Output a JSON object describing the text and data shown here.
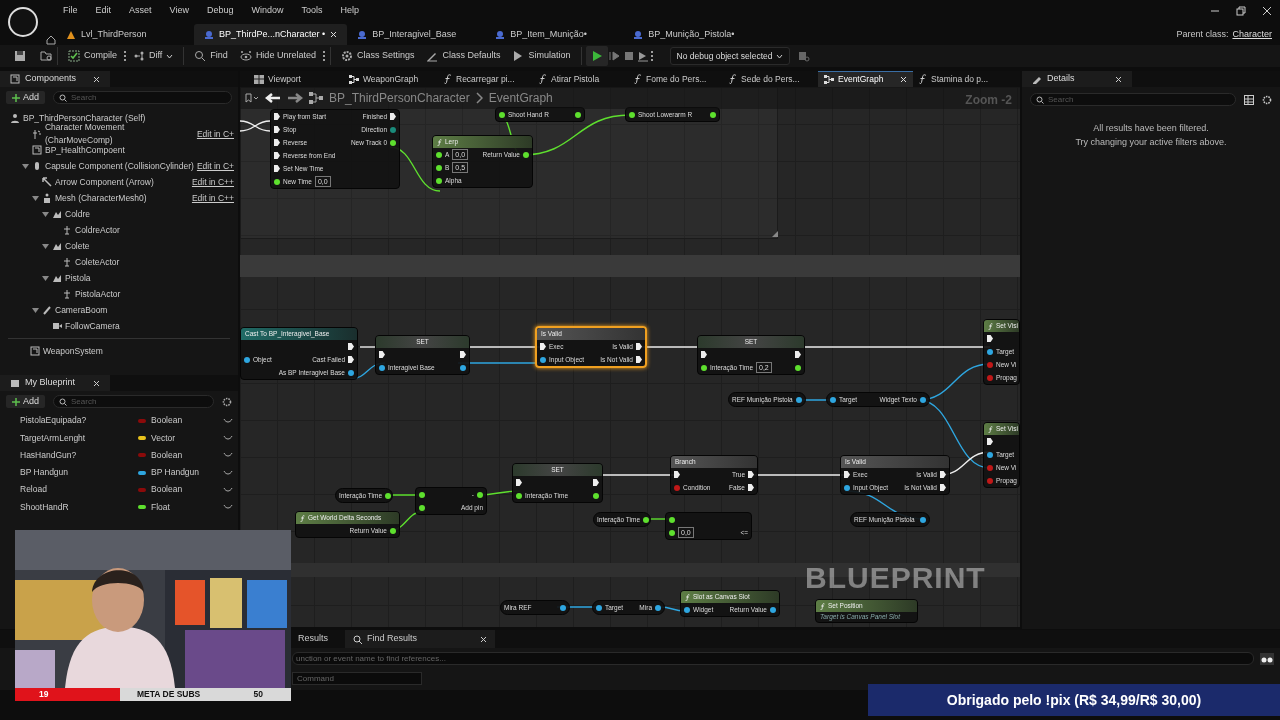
{
  "menu": [
    "File",
    "Edit",
    "Asset",
    "View",
    "Debug",
    "Window",
    "Tools",
    "Help"
  ],
  "doc_tabs": [
    {
      "label": "Lvl_ThirdPerson",
      "kind": "level",
      "selected": false
    },
    {
      "label": "BP_ThirdPe...nCharacter •",
      "kind": "blueprint",
      "selected": true
    },
    {
      "label": "BP_Interagivel_Base",
      "kind": "blueprint",
      "selected": false
    },
    {
      "label": "BP_Item_Munição•",
      "kind": "blueprint",
      "selected": false
    },
    {
      "label": "BP_Munição_Pistola•",
      "kind": "blueprint",
      "selected": false
    }
  ],
  "parent_class": {
    "label": "Parent class:",
    "value": "Character"
  },
  "toolbar": [
    {
      "label": "Compile",
      "kind": "compile",
      "more": true,
      "dropdown": false
    },
    {
      "label": "Diff",
      "kind": "diff",
      "more": false,
      "dropdown": true
    },
    {
      "label": "Find",
      "kind": "find",
      "more": false,
      "dropdown": false
    },
    {
      "label": "Hide Unrelated",
      "kind": "hide",
      "more": true,
      "dropdown": false
    },
    {
      "label": "Class Settings",
      "kind": "settings",
      "more": false,
      "dropdown": false
    },
    {
      "label": "Class Defaults",
      "kind": "defaults",
      "more": false,
      "dropdown": false
    },
    {
      "label": "Simulation",
      "kind": "simulation",
      "more": false,
      "dropdown": false
    }
  ],
  "debug_select": "No debug object selected",
  "components": {
    "title": "Components",
    "add": "Add",
    "search_placeholder": "Search",
    "root": {
      "name": "BP_ThirdPersonCharacter (Self)",
      "kind": "character"
    },
    "tree": [
      {
        "name": "Character Movement (CharMoveComp)",
        "kind": "movement",
        "edit": "Edit in C+"
      },
      {
        "name": "BP_HealthCompoent",
        "kind": "component"
      },
      {
        "name": "Capsule Component (CollisionCylinder)",
        "kind": "capsule",
        "edit": "Edit in C+",
        "expanded": true,
        "children": [
          {
            "name": "Arrow Component (Arrow)",
            "kind": "arrow",
            "edit": "Edit in C++"
          },
          {
            "name": "Mesh (CharacterMesh0)",
            "kind": "mesh",
            "edit": "Edit in C++",
            "expanded": true,
            "children": [
              {
                "name": "Coldre",
                "kind": "socket",
                "expanded": true,
                "children": [
                  {
                    "name": "ColdreActor",
                    "kind": "actor"
                  }
                ]
              },
              {
                "name": "Colete",
                "kind": "socket",
                "expanded": true,
                "children": [
                  {
                    "name": "ColeteActor",
                    "kind": "actor"
                  }
                ]
              },
              {
                "name": "Pistola",
                "kind": "socket",
                "expanded": true,
                "children": [
                  {
                    "name": "PistolaActor",
                    "kind": "actor"
                  }
                ]
              }
            ]
          },
          {
            "name": "CameraBoom",
            "kind": "boom",
            "expanded": true,
            "children": [
              {
                "name": "FollowCamera",
                "kind": "camera"
              }
            ]
          }
        ]
      }
    ],
    "extra": [
      {
        "name": "WeaponSystem",
        "kind": "component"
      }
    ]
  },
  "my_blueprint": {
    "title": "My Blueprint",
    "add": "Add",
    "search_placeholder": "Search",
    "variables": [
      {
        "name": "PistolaEquipada?",
        "type": "Boolean",
        "color": "#8b0a0a"
      },
      {
        "name": "TargetArmLenght",
        "type": "Vector",
        "color": "#e8c21c"
      },
      {
        "name": "HasHandGun?",
        "type": "Boolean",
        "color": "#8b0a0a"
      },
      {
        "name": "BP Handgun",
        "type": "BP Handgun",
        "color": "#2ea6e0"
      },
      {
        "name": "Reload",
        "type": "Boolean",
        "color": "#8b0a0a"
      },
      {
        "name": "ShootHandR",
        "type": "Float",
        "color": "#5ee02e"
      }
    ]
  },
  "graph_tabs": [
    {
      "label": "Viewport",
      "kind": "viewport",
      "selected": false
    },
    {
      "label": "WeaponGraph",
      "kind": "graph",
      "selected": false
    },
    {
      "label": "Recarregar pi...",
      "kind": "function",
      "selected": false
    },
    {
      "label": "Atirar Pistola",
      "kind": "function",
      "selected": false
    },
    {
      "label": "Fome do Pers...",
      "kind": "function",
      "selected": false
    },
    {
      "label": "Sede do Pers...",
      "kind": "function",
      "selected": false
    },
    {
      "label": "EventGraph",
      "kind": "graph",
      "selected": true
    },
    {
      "label": "Stamina do p...",
      "kind": "function",
      "selected": false
    }
  ],
  "breadcrumb": {
    "path": [
      "BP_ThirdPersonCharacter",
      "EventGraph"
    ],
    "zoom": "Zoom -2"
  },
  "graph": {
    "watermark": "BLUEPRINT",
    "nodes": [
      {
        "kind": "timeline",
        "selected": false,
        "rows": [
          {
            "left": "Play from Start",
            "lpin": {
              "kind": "exec"
            },
            "right": "Finished",
            "rpin": {
              "kind": "exec"
            }
          },
          {
            "left": "Stop",
            "lpin": {
              "kind": "exec"
            },
            "right": "Direction",
            "rpin": {
              "kind": "enum"
            }
          },
          {
            "left": "Reverse",
            "lpin": {
              "kind": "exec"
            },
            "right": "New Track 0",
            "rpin": {
              "kind": "float"
            }
          },
          {
            "left": "Reverse from End",
            "lpin": {
              "kind": "exec"
            }
          },
          {
            "left": "Set New Time",
            "lpin": {
              "kind": "exec"
            }
          },
          {
            "left": "New Time",
            "lpin": {
              "kind": "float"
            },
            "value": "0,0"
          }
        ]
      },
      {
        "kind": "set",
        "selected": false,
        "rows": [
          {
            "left": "Shoot Hand R",
            "lpin": {
              "kind": "float"
            },
            "rpin": {
              "kind": "float"
            }
          }
        ]
      },
      {
        "kind": "set",
        "selected": false,
        "rows": [
          {
            "left": "Shoot Lowerarm R",
            "lpin": {
              "kind": "float"
            },
            "rpin": {
              "kind": "float"
            }
          }
        ]
      },
      {
        "title": "Lerp",
        "kind": "function",
        "selected": false,
        "rows": [
          {
            "left": "A",
            "lpin": {
              "kind": "float"
            },
            "value": "0,0",
            "right": "Return Value",
            "rpin": {
              "kind": "float"
            }
          },
          {
            "left": "B",
            "lpin": {
              "kind": "float"
            },
            "value": "0,5"
          },
          {
            "left": "Alpha",
            "lpin": {
              "kind": "float"
            }
          }
        ]
      },
      {
        "title": "Cast To BP_Interagivel_Base",
        "kind": "cast",
        "selected": false,
        "rows": [
          {
            "rpin": {
              "kind": "exec"
            }
          },
          {
            "left": "Object",
            "lpin": {
              "kind": "object"
            },
            "right": "Cast Failed",
            "rpin": {
              "kind": "exec"
            }
          },
          {
            "right": "As BP Interagivel Base",
            "rpin": {
              "kind": "object"
            }
          }
        ]
      },
      {
        "title": "SET",
        "kind": "set",
        "selected": false,
        "rows": [
          {
            "lpin": {
              "kind": "exec"
            },
            "rpin": {
              "kind": "exec"
            }
          },
          {
            "left": "Interagivel Base",
            "lpin": {
              "kind": "object"
            },
            "rpin": {
              "kind": "object"
            }
          }
        ]
      },
      {
        "title": "Is Valid",
        "kind": "macro",
        "selected": true,
        "rows": [
          {
            "left": "Exec",
            "lpin": {
              "kind": "exec"
            },
            "right": "Is Valid",
            "rpin": {
              "kind": "exec"
            }
          },
          {
            "left": "Input Object",
            "lpin": {
              "kind": "object"
            },
            "right": "Is Not Valid",
            "rpin": {
              "kind": "exec"
            }
          }
        ]
      },
      {
        "title": "SET",
        "kind": "set",
        "selected": false,
        "rows": [
          {
            "lpin": {
              "kind": "exec"
            },
            "rpin": {
              "kind": "exec"
            }
          },
          {
            "left": "Interação Time",
            "lpin": {
              "kind": "float"
            },
            "value": "0,2",
            "rpin": {
              "kind": "float"
            }
          }
        ]
      },
      {
        "title": "Set Visi",
        "kind": "function",
        "selected": false,
        "rows": [
          {
            "lpin": {
              "kind": "exec"
            }
          },
          {
            "left": "Target",
            "lpin": {
              "kind": "object"
            }
          },
          {
            "left": "New Vi",
            "lpin": {
              "kind": "bool"
            }
          },
          {
            "left": "Propag",
            "lpin": {
              "kind": "bool"
            }
          }
        ]
      },
      {
        "kind": "getter",
        "selected": false,
        "rows": [
          {
            "left": "REF Munição Pistola",
            "rpin": {
              "kind": "object"
            }
          }
        ]
      },
      {
        "kind": "getter",
        "selected": false,
        "rows": [
          {
            "left": "Target",
            "lpin": {
              "kind": "object"
            },
            "right": "Widget Texto",
            "rpin": {
              "kind": "object"
            }
          }
        ]
      },
      {
        "title": "Set Visi",
        "kind": "function",
        "selected": false,
        "rows": [
          {
            "lpin": {
              "kind": "exec"
            }
          },
          {
            "left": "Target",
            "lpin": {
              "kind": "object"
            }
          },
          {
            "left": "New Vi",
            "lpin": {
              "kind": "bool"
            }
          },
          {
            "left": "Propag",
            "lpin": {
              "kind": "bool"
            }
          }
        ]
      },
      {
        "kind": "getter",
        "selected": false,
        "rows": [
          {
            "left": "Interação Time",
            "rpin": {
              "kind": "float"
            }
          }
        ]
      },
      {
        "title": "Get World Delta Seconds",
        "kind": "function",
        "selected": false,
        "rows": [
          {
            "right": "Return Value",
            "rpin": {
              "kind": "float"
            }
          }
        ]
      },
      {
        "kind": "operator",
        "selected": false,
        "rows": [
          {
            "lpin": {
              "kind": "float"
            },
            "right": "-",
            "rpin": {
              "kind": "float"
            }
          },
          {
            "lpin": {
              "kind": "float"
            },
            "right": "Add pin"
          }
        ]
      },
      {
        "title": "SET",
        "kind": "set",
        "selected": false,
        "rows": [
          {
            "lpin": {
              "kind": "exec"
            },
            "rpin": {
              "kind": "exec"
            }
          },
          {
            "left": "Interação Time",
            "lpin": {
              "kind": "float"
            },
            "rpin": {
              "kind": "float"
            }
          }
        ]
      },
      {
        "title": "Branch",
        "kind": "macro",
        "selected": false,
        "rows": [
          {
            "lpin": {
              "kind": "exec"
            },
            "right": "True",
            "rpin": {
              "kind": "exec"
            }
          },
          {
            "left": "Condition",
            "lpin": {
              "kind": "bool"
            },
            "right": "False",
            "rpin": {
              "kind": "exec"
            }
          }
        ]
      },
      {
        "kind": "getter",
        "selected": false,
        "rows": [
          {
            "left": "Interação Time",
            "rpin": {
              "kind": "float"
            }
          }
        ]
      },
      {
        "kind": "operator",
        "selected": false,
        "rows": [
          {
            "lpin": {
              "kind": "float"
            }
          },
          {
            "lpin": {
              "kind": "float"
            },
            "value": "0,0",
            "right": "<="
          }
        ]
      },
      {
        "title": "Is Valid",
        "kind": "macro",
        "selected": false,
        "rows": [
          {
            "left": "Exec",
            "lpin": {
              "kind": "exec"
            },
            "right": "Is Valid",
            "rpin": {
              "kind": "exec"
            }
          },
          {
            "left": "Input Object",
            "lpin": {
              "kind": "object"
            },
            "right": "Is Not Valid",
            "rpin": {
              "kind": "exec"
            }
          }
        ]
      },
      {
        "kind": "getter",
        "selected": false,
        "rows": [
          {
            "left": "REF Munição Pistola",
            "rpin": {
              "kind": "object"
            }
          }
        ]
      },
      {
        "kind": "getter",
        "selected": false,
        "rows": [
          {
            "left": "Mira REF",
            "rpin": {
              "kind": "object"
            }
          }
        ]
      },
      {
        "kind": "getter",
        "selected": false,
        "rows": [
          {
            "left": "Target",
            "lpin": {
              "kind": "object"
            },
            "right": "Mira",
            "rpin": {
              "kind": "object"
            }
          }
        ]
      },
      {
        "title": "Slot as Canvas Slot",
        "kind": "function",
        "selected": false,
        "rows": [
          {
            "left": "Widget",
            "lpin": {
              "kind": "object"
            },
            "right": "Return Value",
            "rpin": {
              "kind": "object"
            }
          }
        ]
      },
      {
        "title": "Set Position",
        "subtitle": "Target is Canvas Panel Slot",
        "kind": "function",
        "selected": false
      }
    ]
  },
  "details": {
    "title": "Details",
    "search_placeholder": "Search",
    "messages": [
      "All results have been filtered.",
      "Try changing your active filters above."
    ]
  },
  "bottom": {
    "tabs": [
      {
        "label": "Results",
        "selected": false
      },
      {
        "label": "Find Results",
        "selected": true
      }
    ],
    "find_placeholder": "unction or event name to find references...",
    "command_placeholder": "Command"
  },
  "overlay": {
    "subs_goal": {
      "label": "META DE SUBS",
      "current": "19",
      "target": "50",
      "level": 0.38
    },
    "banner": "Obrigado pelo !pix (R$ 34,99/R$ 30,00)"
  }
}
